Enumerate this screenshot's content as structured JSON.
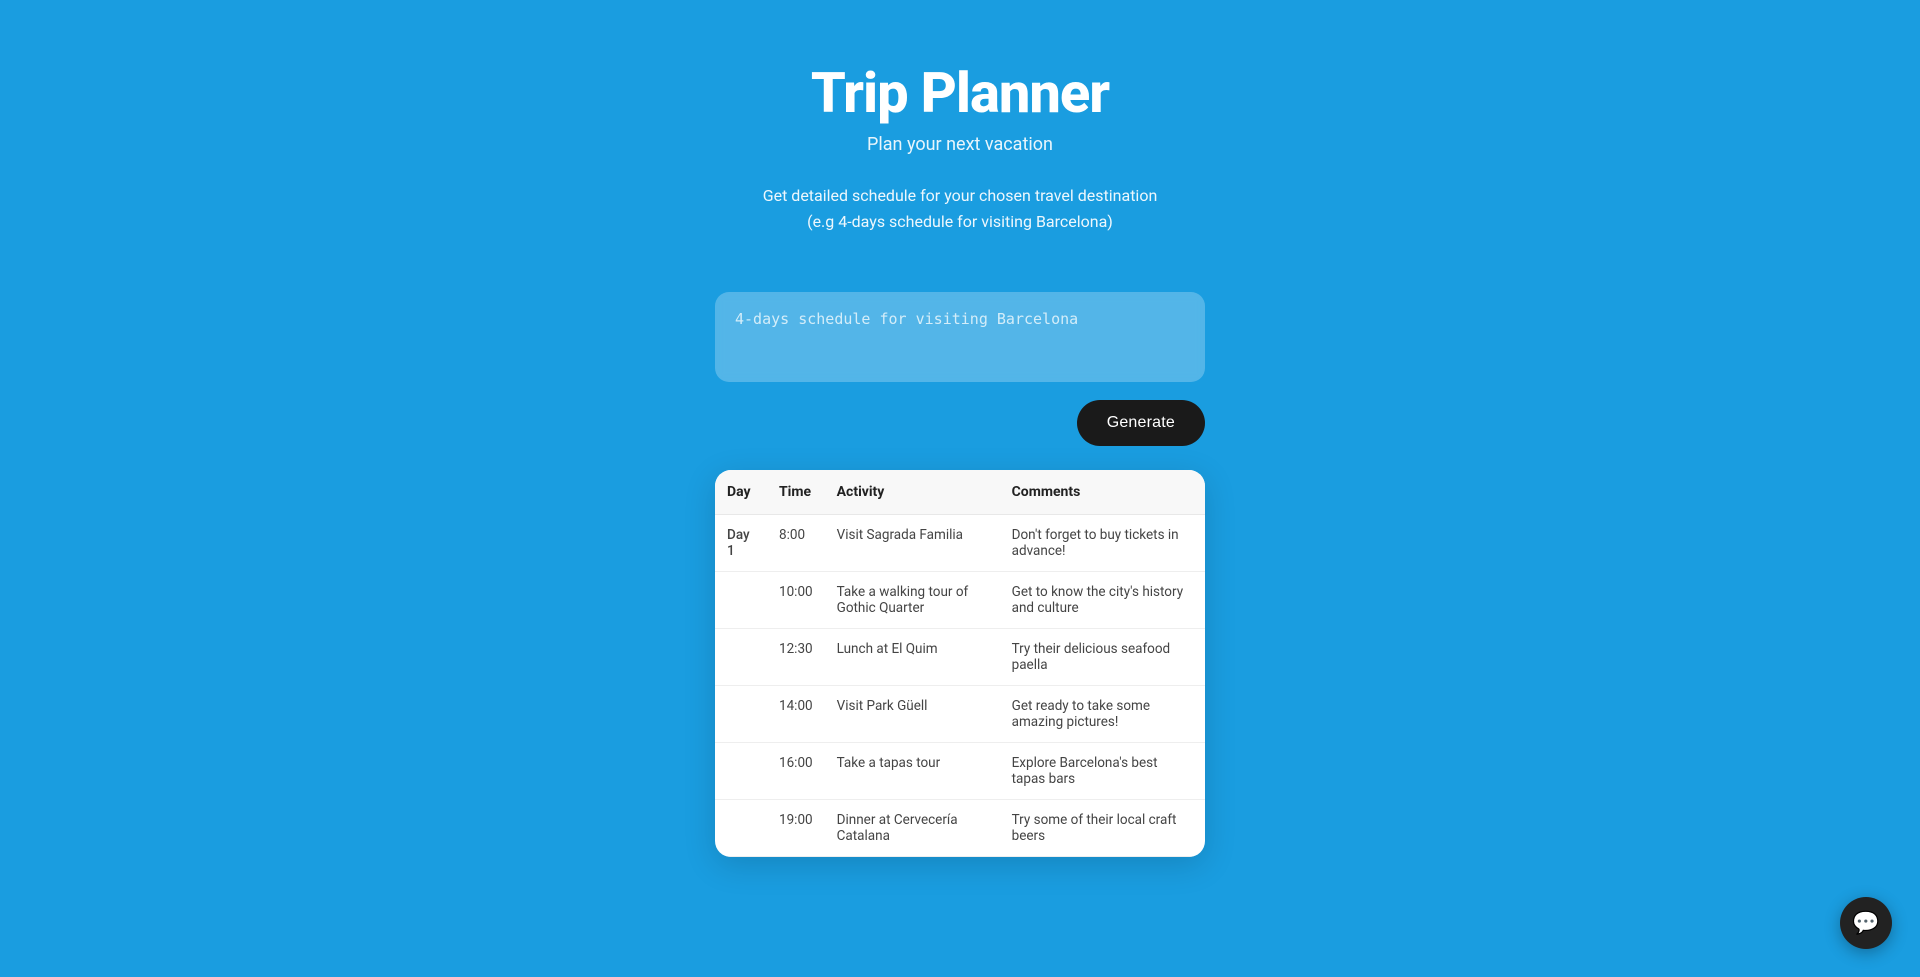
{
  "header": {
    "title": "Trip Planner",
    "subtitle": "Plan your next vacation",
    "description": "Get detailed schedule for your chosen travel destination\n(e.g 4-days schedule for visiting Barcelona)"
  },
  "input": {
    "placeholder": "4-days schedule for visiting Barcelona",
    "value": ""
  },
  "buttons": {
    "generate": "Generate"
  },
  "table": {
    "columns": [
      "Day",
      "Time",
      "Activity",
      "Comments"
    ],
    "rows": [
      {
        "day": "Day 1",
        "time": "8:00",
        "activity": "Visit Sagrada Familia",
        "comments": "Don't forget to buy tickets in advance!"
      },
      {
        "day": "",
        "time": "10:00",
        "activity": "Take a walking tour of Gothic Quarter",
        "comments": "Get to know the city's history and culture"
      },
      {
        "day": "",
        "time": "12:30",
        "activity": "Lunch at El Quim",
        "comments": "Try their delicious seafood paella"
      },
      {
        "day": "",
        "time": "14:00",
        "activity": "Visit Park Güell",
        "comments": "Get ready to take some amazing pictures!"
      },
      {
        "day": "",
        "time": "16:00",
        "activity": "Take a tapas tour",
        "comments": "Explore Barcelona's best tapas bars"
      },
      {
        "day": "",
        "time": "19:00",
        "activity": "Dinner at Cervecería Catalana",
        "comments": "Try some of their local craft beers"
      }
    ]
  },
  "chat": {
    "icon": "💬"
  }
}
